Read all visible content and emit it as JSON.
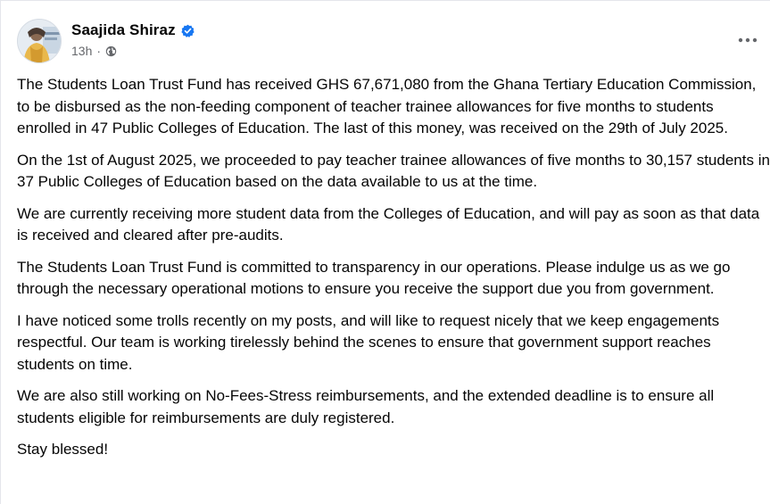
{
  "post": {
    "author": "Saajida Shiraz",
    "timestamp": "13h",
    "separator": "·",
    "verified_icon": "verified-badge-icon",
    "privacy_icon": "globe-icon",
    "more_icon": "more-options-icon",
    "accent_color": "#1877f2",
    "paragraphs": [
      "The Students Loan Trust Fund has received GHS 67,671,080 from the Ghana Tertiary Education Commission, to be disbursed as the non-feeding component of teacher trainee allowances for five months to students enrolled in 47 Public Colleges of Education. The last of this money, was received on the 29th of July 2025.",
      "On the 1st of August 2025, we proceeded to pay teacher trainee allowances of five months to 30,157 students in 37 Public Colleges of Education based on the data available to us at the time.",
      "We are currently receiving more student data from the Colleges of Education, and will pay as soon as that data is received and cleared after pre-audits.",
      "The Students Loan Trust Fund is committed to transparency in our operations. Please indulge us as we go through the necessary operational motions to ensure you receive the support due you from government.",
      "I have noticed some trolls recently on my posts, and will like to request nicely that we keep engagements respectful. Our team is working tirelessly behind the scenes to ensure that government support reaches students on time.",
      "We are also still working on No-Fees-Stress reimbursements, and the extended deadline is to ensure all students eligible for reimbursements are duly registered.",
      "Stay blessed!"
    ]
  }
}
